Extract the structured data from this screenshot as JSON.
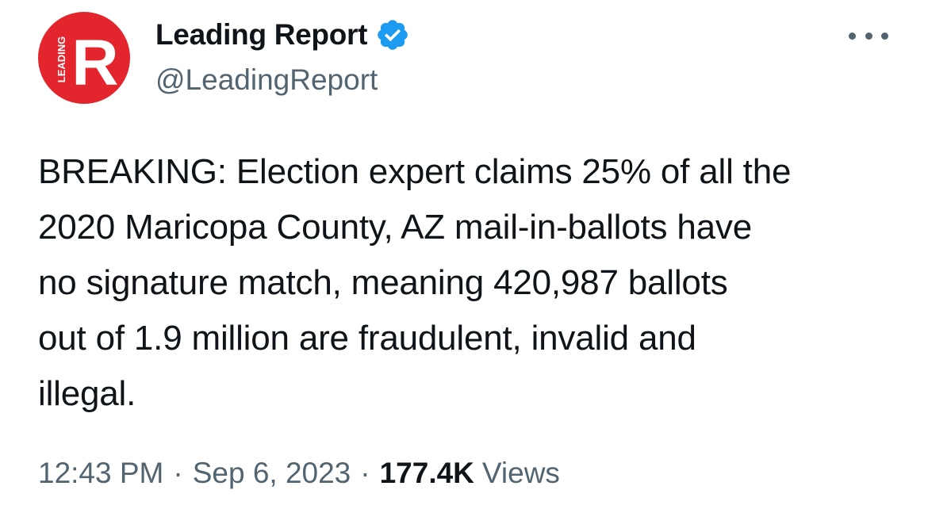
{
  "author": {
    "display_name": "Leading Report",
    "handle": "@LeadingReport",
    "verified": true,
    "avatar_text": "LEADING",
    "avatar_letter": "R"
  },
  "tweet": {
    "text_lines": [
      "BREAKING: Election expert claims 25% of all the",
      "2020 Maricopa County, AZ mail-in-ballots have",
      "no signature match, meaning 420,987 ballots",
      "out of 1.9 million are fraudulent, invalid and",
      "illegal."
    ],
    "time": "12:43 PM",
    "date": "Sep 6, 2023",
    "separator": "·",
    "views_count": "177.4K",
    "views_label": "Views"
  },
  "colors": {
    "brand_red": "#e3262e",
    "verified_blue": "#1d9bf0",
    "text_primary": "#0f1419",
    "text_secondary": "#536471"
  },
  "icons": {
    "verified": "verified-badge-icon",
    "more": "more-options-icon"
  }
}
